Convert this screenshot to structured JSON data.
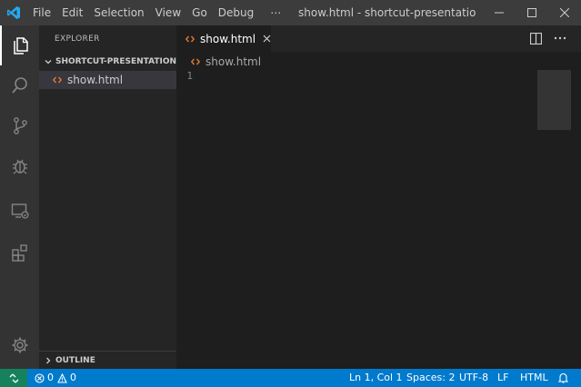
{
  "titlebar": {
    "menu": [
      "File",
      "Edit",
      "Selection",
      "View",
      "Go",
      "Debug",
      "⋯"
    ],
    "window_title": "show.html - shortcut-presentation [Ad..."
  },
  "activitybar": {
    "items": [
      "explorer",
      "search",
      "source-control",
      "debug",
      "remote-explorer",
      "extensions"
    ],
    "active": "explorer"
  },
  "sidebar": {
    "title": "EXPLORER",
    "folder": "SHORTCUT-PRESENTATION",
    "files": [
      "show.html"
    ],
    "outline": "OUTLINE"
  },
  "editor": {
    "tab_label": "show.html",
    "breadcrumb": "show.html",
    "line_numbers": [
      "1"
    ]
  },
  "statusbar": {
    "errors": "0",
    "warnings": "0",
    "position": "Ln 1, Col 1",
    "spaces": "Spaces: 2",
    "encoding": "UTF-8",
    "eol": "LF",
    "language": "HTML"
  },
  "colors": {
    "accent": "#007acc",
    "remote": "#16825d",
    "html_icon": "#e37933",
    "vscode_blue": "#23a9f2"
  }
}
